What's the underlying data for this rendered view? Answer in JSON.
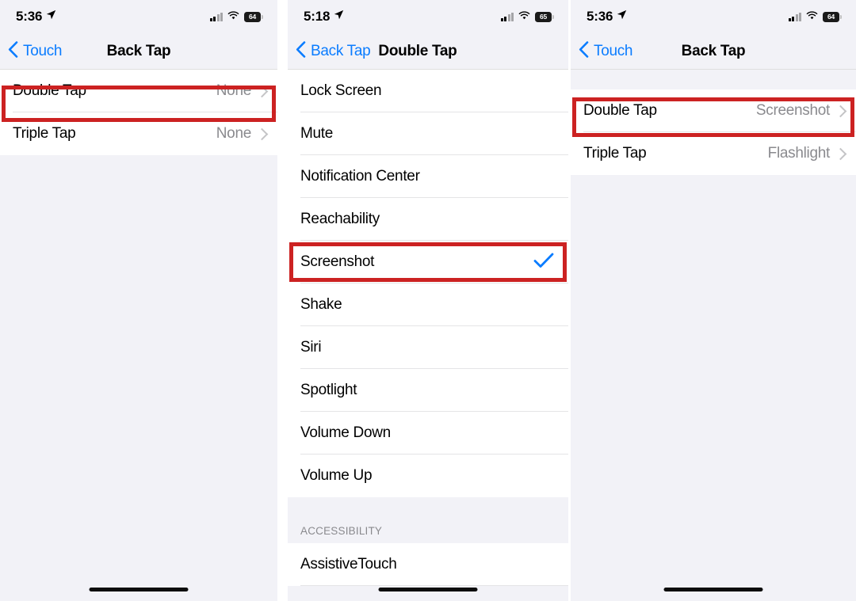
{
  "panels": [
    {
      "id": "panel-back-tap-before",
      "status": {
        "time": "5:36",
        "battery": "64",
        "location_icon": "location-arrow-icon",
        "signal_icon": "cellular-bars-icon",
        "wifi_icon": "wifi-icon"
      },
      "nav": {
        "back_label": "Touch",
        "title": "Back Tap"
      },
      "rows": [
        {
          "label": "Double Tap",
          "value": "None",
          "accessory": "chevron"
        },
        {
          "label": "Triple Tap",
          "value": "None",
          "accessory": "chevron"
        }
      ]
    },
    {
      "id": "panel-double-tap-options",
      "status": {
        "time": "5:18",
        "battery": "65",
        "location_icon": "location-arrow-icon",
        "signal_icon": "cellular-bars-icon",
        "wifi_icon": "wifi-icon"
      },
      "nav": {
        "back_label": "Back Tap",
        "title": "Double Tap"
      },
      "rows": [
        {
          "label": "Lock Screen",
          "value": "",
          "accessory": "none"
        },
        {
          "label": "Mute",
          "value": "",
          "accessory": "none"
        },
        {
          "label": "Notification Center",
          "value": "",
          "accessory": "none"
        },
        {
          "label": "Reachability",
          "value": "",
          "accessory": "none"
        },
        {
          "label": "Screenshot",
          "value": "",
          "accessory": "check"
        },
        {
          "label": "Shake",
          "value": "",
          "accessory": "none"
        },
        {
          "label": "Siri",
          "value": "",
          "accessory": "none"
        },
        {
          "label": "Spotlight",
          "value": "",
          "accessory": "none"
        },
        {
          "label": "Volume Down",
          "value": "",
          "accessory": "none"
        },
        {
          "label": "Volume Up",
          "value": "",
          "accessory": "none"
        }
      ],
      "section_header": "ACCESSIBILITY",
      "rows2": [
        {
          "label": "AssistiveTouch",
          "value": "",
          "accessory": "none"
        }
      ]
    },
    {
      "id": "panel-back-tap-after",
      "status": {
        "time": "5:36",
        "battery": "64",
        "location_icon": "location-arrow-icon",
        "signal_icon": "cellular-bars-icon",
        "wifi_icon": "wifi-icon"
      },
      "nav": {
        "back_label": "Touch",
        "title": "Back Tap"
      },
      "rows": [
        {
          "label": "Double Tap",
          "value": "Screenshot",
          "accessory": "chevron"
        },
        {
          "label": "Triple Tap",
          "value": "Flashlight",
          "accessory": "chevron"
        }
      ]
    }
  ],
  "colors": {
    "accent_blue": "#0a7cff",
    "highlight_red": "#cc2222",
    "value_gray": "#8a8a8e",
    "page_bg": "#f2f2f7"
  }
}
